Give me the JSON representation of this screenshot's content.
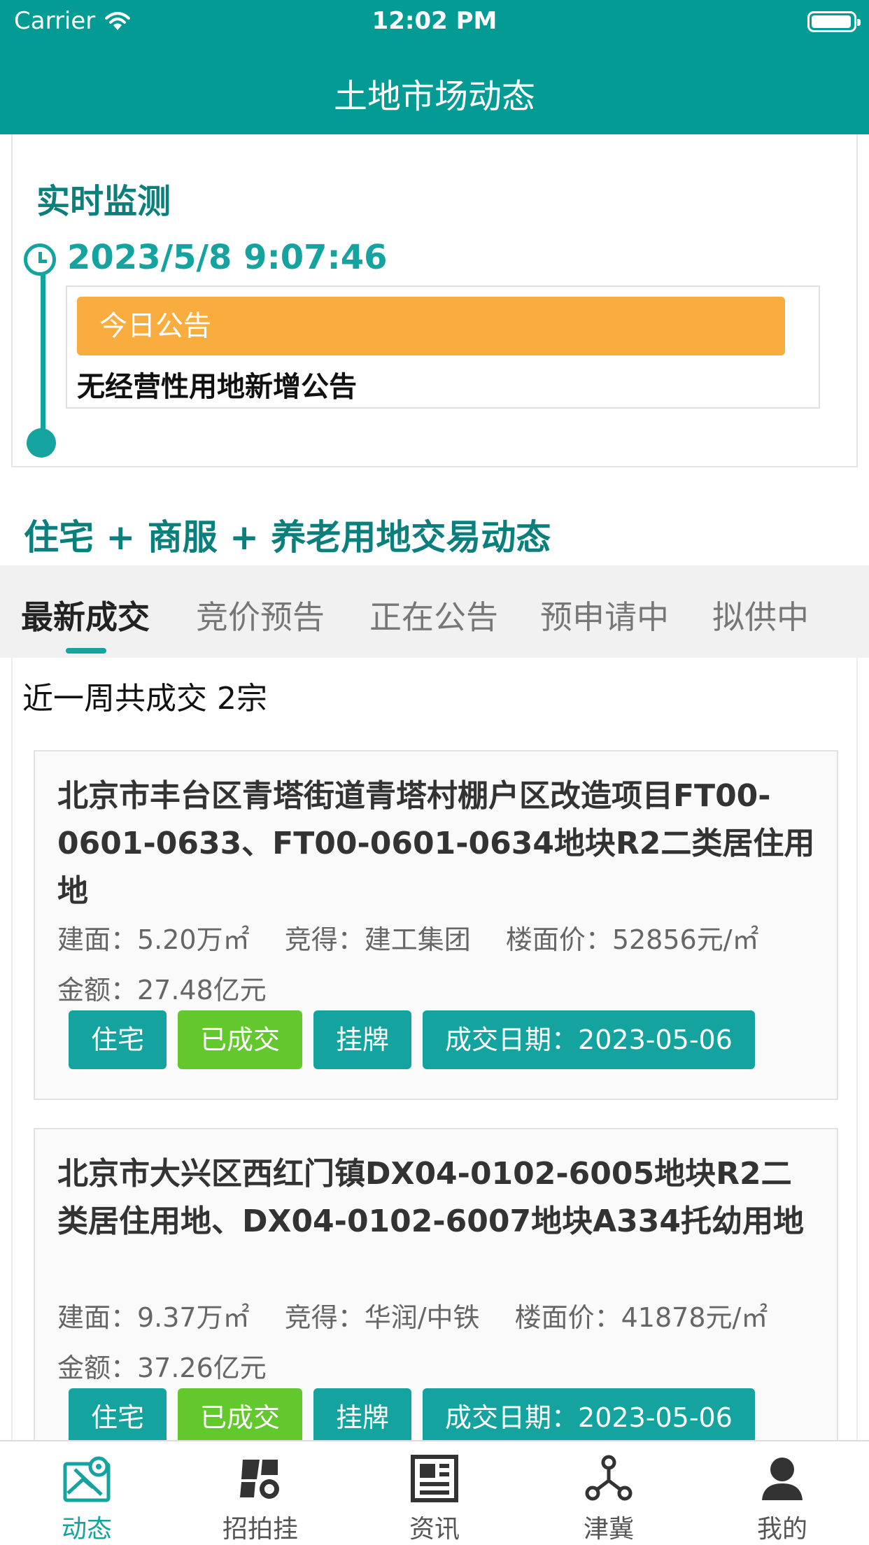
{
  "status": {
    "carrier": "Carrier",
    "time": "12:02 PM"
  },
  "nav": {
    "title": "土地市场动态"
  },
  "realtime": {
    "title": "实时监测",
    "time": "2023/5/8 9:07:46",
    "badge": "今日公告",
    "notice": "无经营性用地新增公告"
  },
  "deals_heading": "住宅 + 商服 + 养老用地交易动态",
  "tabs": [
    "最新成交",
    "竞价预告",
    "正在公告",
    "预申请中",
    "拟供中"
  ],
  "summary": "近一周共成交 2宗",
  "deals": [
    {
      "name": "北京市丰台区青塔街道青塔村棚户区改造项目FT00-0601-0633、FT00-0601-0634地块R2二类居住用地",
      "area": "建面：5.20万㎡",
      "winner": "竞得：建工集团",
      "price": "楼面价：52856元/㎡",
      "amount": "金额：27.48亿元",
      "tags": [
        "住宅",
        "已成交",
        "挂牌",
        "成交日期：2023-05-06"
      ]
    },
    {
      "name": "北京市大兴区西红门镇DX04-0102-6005地块R2二类居住用地、DX04-0102-6007地块A334托幼用地",
      "area": "建面：9.37万㎡",
      "winner": "竞得：华润/中铁",
      "price": "楼面价：41878元/㎡",
      "amount": "金额：37.26亿元",
      "tags": [
        "住宅",
        "已成交",
        "挂牌",
        "成交日期：2023-05-06"
      ]
    }
  ],
  "tabbar": [
    "动态",
    "招拍挂",
    "资讯",
    "津冀",
    "我的"
  ],
  "colors": {
    "primary": "#049B95",
    "accent": "#14A39E",
    "badge": "#F9AD3E",
    "success": "#63C82E"
  }
}
